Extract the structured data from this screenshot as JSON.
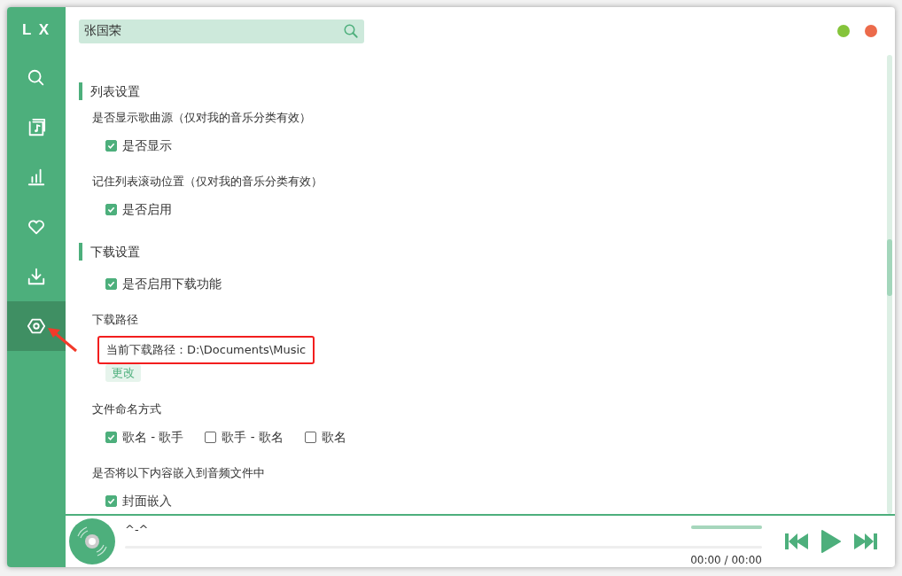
{
  "app": {
    "logo": "L X"
  },
  "sidebar": {
    "items": [
      {
        "selected": false
      },
      {
        "selected": false
      },
      {
        "selected": false
      },
      {
        "selected": false
      },
      {
        "selected": false
      },
      {
        "selected": true
      }
    ]
  },
  "search": {
    "value": "张国荣"
  },
  "window_controls": [
    {
      "color": "#85c43b"
    },
    {
      "color": "#ec6b4b"
    }
  ],
  "sections": [
    {
      "title": "列表设置",
      "items": [
        {
          "kind": "label",
          "text": "是否显示歌曲源（仅对我的音乐分类有效）"
        },
        {
          "kind": "checkboxes",
          "options": [
            {
              "label": "是否显示",
              "checked": true
            }
          ]
        },
        {
          "kind": "label",
          "text": "记住列表滚动位置（仅对我的音乐分类有效）"
        },
        {
          "kind": "checkboxes",
          "options": [
            {
              "label": "是否启用",
              "checked": true
            }
          ]
        }
      ]
    },
    {
      "title": "下载设置",
      "items": [
        {
          "kind": "checkboxes",
          "options": [
            {
              "label": "是否启用下载功能",
              "checked": true
            }
          ]
        },
        {
          "kind": "label",
          "text": "下载路径"
        },
        {
          "kind": "path",
          "text": "当前下载路径：D:\\Documents\\Music",
          "button": "更改"
        },
        {
          "kind": "label",
          "text": "文件命名方式"
        },
        {
          "kind": "checkboxes",
          "options": [
            {
              "label": "歌名 - 歌手",
              "checked": true
            },
            {
              "label": "歌手 - 歌名",
              "checked": false
            },
            {
              "label": "歌名",
              "checked": false
            }
          ]
        },
        {
          "kind": "label",
          "text": "是否将以下内容嵌入到音频文件中"
        },
        {
          "kind": "checkboxes",
          "options": [
            {
              "label": "封面嵌入",
              "checked": true
            }
          ]
        }
      ]
    }
  ],
  "player": {
    "title": "^-^",
    "progress": {
      "level": 0
    },
    "volume": {
      "level": 1
    },
    "time": "00:00 / 00:00"
  }
}
